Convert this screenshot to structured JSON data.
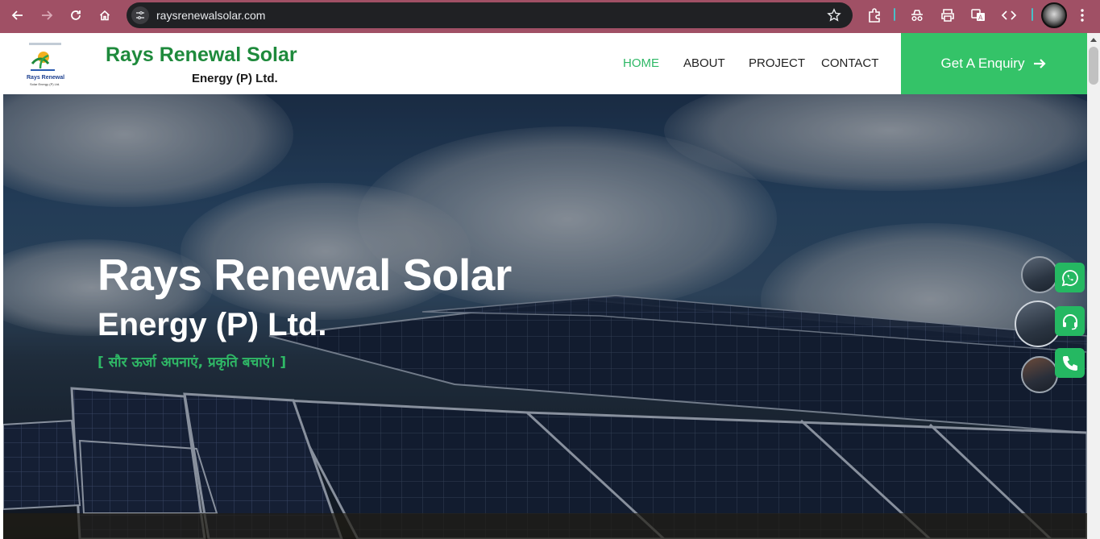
{
  "browser": {
    "url": "raysrenewalsolar.com"
  },
  "header": {
    "logo_alt": "Rays Renewal",
    "logo_subtext": "Solar Energy (P) Ltd.",
    "brand_line1": "Rays Renewal Solar",
    "brand_line2": "Energy (P) Ltd.",
    "nav": [
      {
        "label": "HOME",
        "active": true
      },
      {
        "label": "ABOUT",
        "active": false
      },
      {
        "label": "PROJECT",
        "active": false
      },
      {
        "label": "CONTACT",
        "active": false
      }
    ],
    "enquiry_label": "Get A Enquiry"
  },
  "hero": {
    "title": "Rays Renewal Solar",
    "subtitle": "Energy (P) Ltd.",
    "tagline": "[ सौर ऊर्जा अपनाएं, प्रकृति बचाएं। ]"
  },
  "floating": {
    "whatsapp_icon": "whatsapp-icon",
    "support_icon": "headset-icon",
    "phone_icon": "phone-icon"
  },
  "colors": {
    "brand_green": "#1e8a3c",
    "accent_green": "#34c368",
    "chrome_bg": "#a05065"
  }
}
